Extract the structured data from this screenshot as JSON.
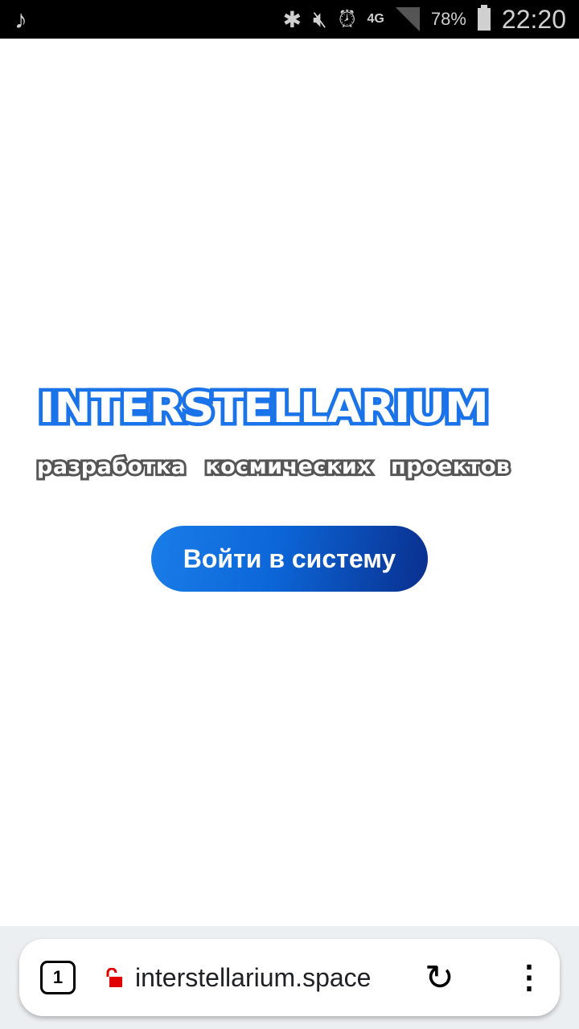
{
  "status_bar": {
    "battery": "78%",
    "time": "22:20",
    "network": "4G",
    "icons": [
      "music-note-icon",
      "bluetooth-icon",
      "mute-icon",
      "alarm-icon",
      "signal-icon",
      "battery-icon"
    ]
  },
  "logo": {
    "title": "INTERSTELLARIUM",
    "tagline": "разработка космических проектов"
  },
  "login_button": "Войти в систему",
  "browser": {
    "tab_count": "1",
    "url": "interstellarium.space",
    "lock_color": "#e00000"
  },
  "colors": {
    "accent": "#1a73e8",
    "accent_dark": "#0a2f8e"
  }
}
